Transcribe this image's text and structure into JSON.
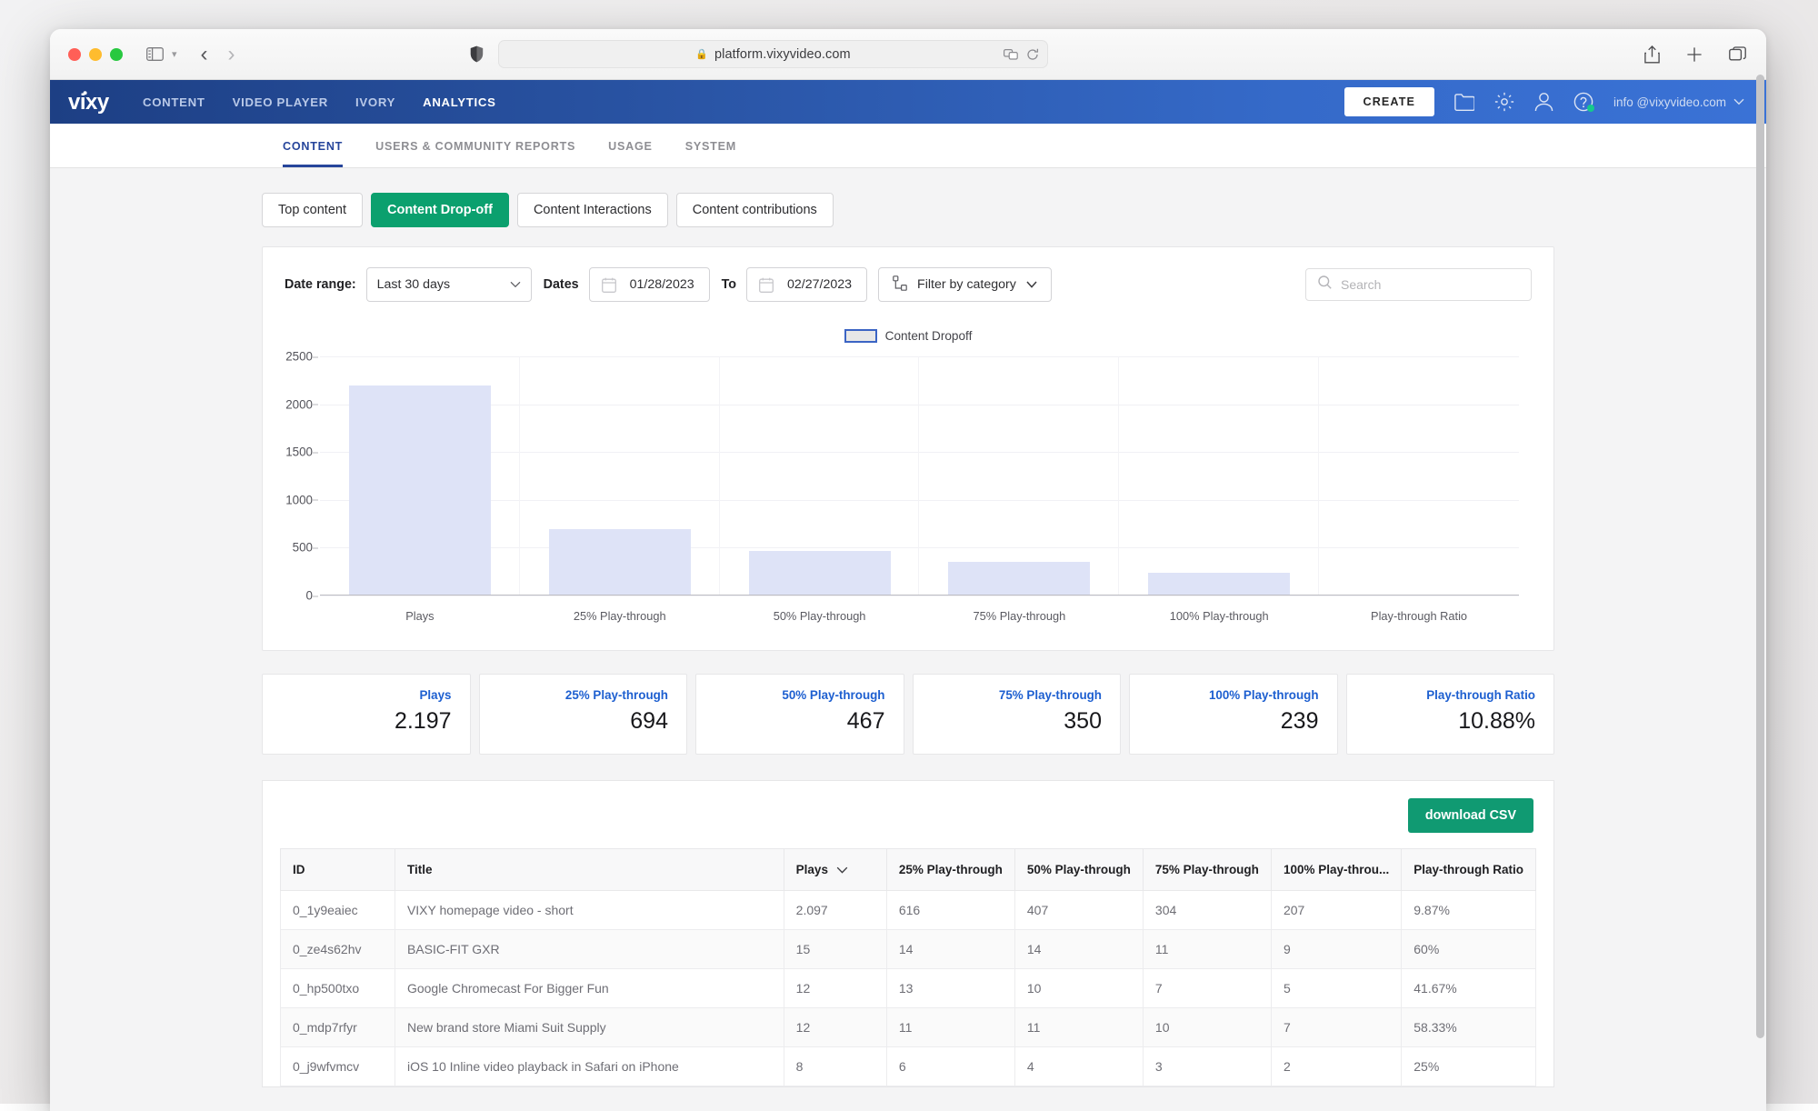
{
  "browser": {
    "url": "platform.vixyvideo.com",
    "lock_icon": "lock-icon",
    "shield_icon": "shield-icon",
    "sidebar_icon": "sidebar-toggle-icon",
    "back_icon": "back-arrow-icon",
    "forward_icon": "forward-arrow-icon",
    "reader_icon": "reader-view-icon",
    "reload_icon": "reload-icon",
    "share_icon": "share-icon",
    "newtab_icon": "plus-icon",
    "tabs_icon": "tab-overview-icon"
  },
  "navbar": {
    "brand": "vixy",
    "links": [
      {
        "label": "CONTENT",
        "active": false
      },
      {
        "label": "VIDEO PLAYER",
        "active": false
      },
      {
        "label": "IVORY",
        "active": false
      },
      {
        "label": "ANALYTICS",
        "active": true
      }
    ],
    "create_label": "CREATE",
    "folder_icon": "folder-icon",
    "gear_icon": "gear-icon",
    "user_icon": "user-icon",
    "help_icon": "help-icon",
    "account_email": "info @vixyvideo.com",
    "chevron_icon": "chevron-down-icon"
  },
  "subtabs": [
    {
      "label": "CONTENT",
      "active": true
    },
    {
      "label": "USERS & COMMUNITY REPORTS",
      "active": false
    },
    {
      "label": "USAGE",
      "active": false
    },
    {
      "label": "SYSTEM",
      "active": false
    }
  ],
  "segments": [
    {
      "label": "Top content",
      "active": false
    },
    {
      "label": "Content Drop-off",
      "active": true
    },
    {
      "label": "Content Interactions",
      "active": false
    },
    {
      "label": "Content contributions",
      "active": false
    }
  ],
  "filters": {
    "date_range_label": "Date range:",
    "date_range_value": "Last 30 days",
    "dates_label": "Dates",
    "date_from": "01/28/2023",
    "to_label": "To",
    "date_to": "02/27/2023",
    "category_filter_label": "Filter by category",
    "calendar_icon": "calendar-icon",
    "category_icon": "category-filter-icon",
    "search_icon": "search-icon",
    "search_placeholder": "Search",
    "search_value": ""
  },
  "chart_data": {
    "type": "bar",
    "title": "",
    "legend": [
      "Content Dropoff"
    ],
    "legend_position": "top-center",
    "categories": [
      "Plays",
      "25% Play-through",
      "50% Play-through",
      "75% Play-through",
      "100% Play-through",
      "Play-through Ratio"
    ],
    "values": [
      2197,
      694,
      467,
      350,
      239,
      0
    ],
    "xlabel": "",
    "ylabel": "",
    "ylim": [
      0,
      2500
    ],
    "yticks": [
      0,
      500,
      1000,
      1500,
      2000,
      2500
    ],
    "grid": true,
    "bar_color": "#dee3f7"
  },
  "stats": [
    {
      "label": "Plays",
      "value": "2.197"
    },
    {
      "label": "25% Play-through",
      "value": "694"
    },
    {
      "label": "50% Play-through",
      "value": "467"
    },
    {
      "label": "75% Play-through",
      "value": "350"
    },
    {
      "label": "100% Play-through",
      "value": "239"
    },
    {
      "label": "Play-through Ratio",
      "value": "10.88%"
    }
  ],
  "table": {
    "download_label": "download CSV",
    "sort_icon": "chevron-down-icon",
    "columns": [
      "ID",
      "Title",
      "Plays",
      "25% Play-through",
      "50% Play-through",
      "75% Play-through",
      "100% Play-throu...",
      "Play-through Ratio"
    ],
    "sorted_column": "Plays",
    "rows": [
      [
        "0_1y9eaiec",
        "VIXY homepage video - short",
        "2.097",
        "616",
        "407",
        "304",
        "207",
        "9.87%"
      ],
      [
        "0_ze4s62hv",
        "BASIC-FIT GXR",
        "15",
        "14",
        "14",
        "11",
        "9",
        "60%"
      ],
      [
        "0_hp500txo",
        "Google Chromecast For Bigger Fun",
        "12",
        "13",
        "10",
        "7",
        "5",
        "41.67%"
      ],
      [
        "0_mdp7rfyr",
        "New brand store Miami Suit Supply",
        "12",
        "11",
        "11",
        "10",
        "7",
        "58.33%"
      ],
      [
        "0_j9wfvmcv",
        "iOS 10 Inline video playback in Safari on iPhone",
        "8",
        "6",
        "4",
        "3",
        "2",
        "25%"
      ]
    ]
  },
  "colors": {
    "brand_blue": "#26459b",
    "accent_green": "#0ba06e",
    "link_blue": "#1d5fd0",
    "bar": "#dee3f7"
  }
}
